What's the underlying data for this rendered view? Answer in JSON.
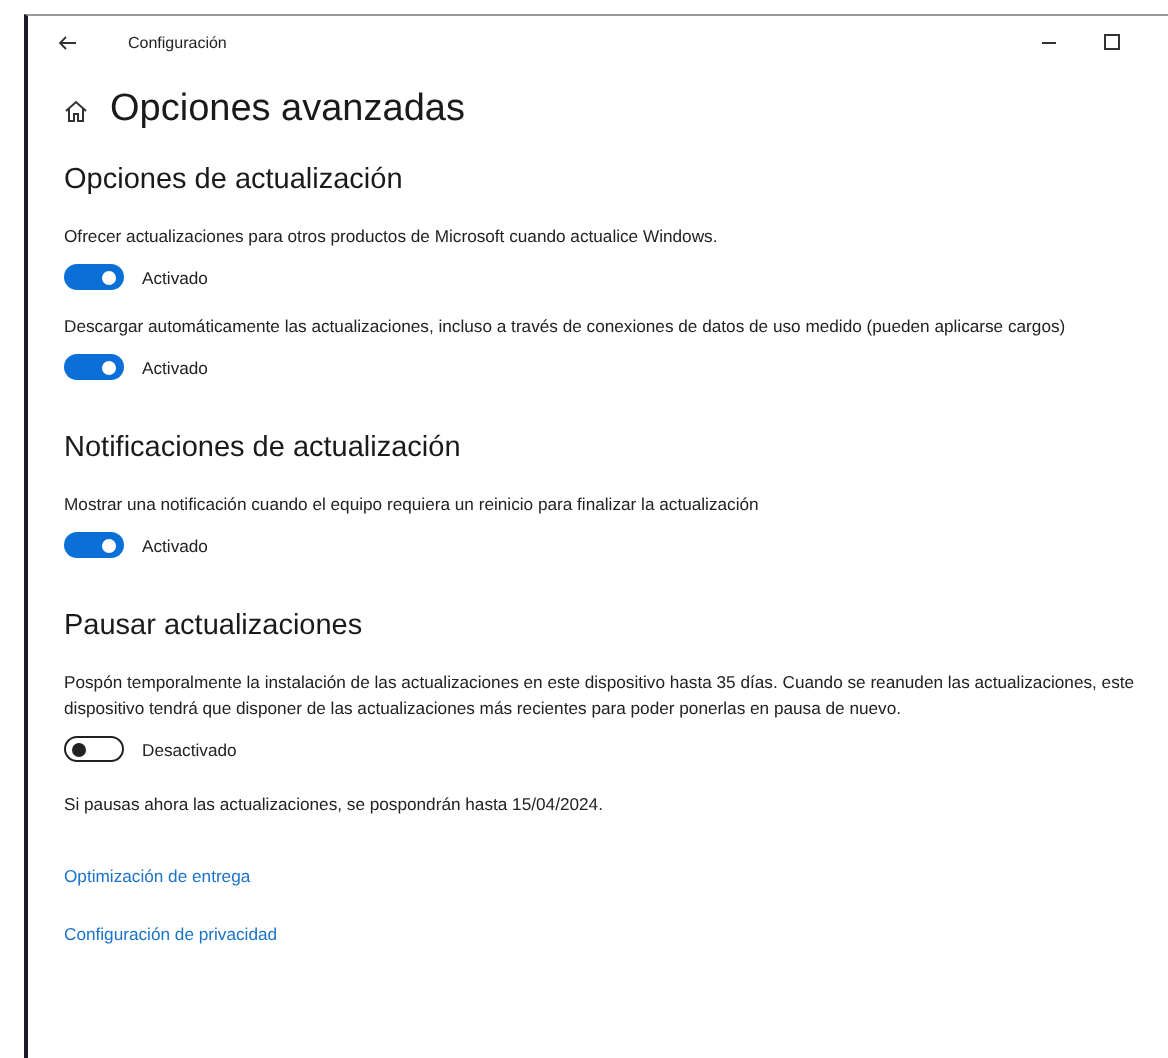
{
  "window": {
    "title": "Configuración"
  },
  "page": {
    "title": "Opciones avanzadas"
  },
  "sections": [
    {
      "title": "Opciones de actualización",
      "items": [
        {
          "kind": "toggle",
          "description": "Ofrecer actualizaciones para otros productos de Microsoft cuando actualice Windows.",
          "on": true,
          "state_label": "Activado"
        },
        {
          "kind": "toggle",
          "description": "Descargar automáticamente las actualizaciones, incluso a través de conexiones de datos de uso medido (pueden aplicarse cargos)",
          "on": true,
          "state_label": "Activado"
        }
      ]
    },
    {
      "title": "Notificaciones de actualización",
      "items": [
        {
          "kind": "toggle",
          "description": "Mostrar una notificación cuando el equipo requiera un reinicio para finalizar la actualización",
          "on": true,
          "state_label": "Activado"
        }
      ]
    },
    {
      "title": "Pausar actualizaciones",
      "items": [
        {
          "kind": "toggle",
          "description": "Pospón temporalmente la instalación de las actualizaciones en este dispositivo hasta 35 días. Cuando se reanuden las actualizaciones, este dispositivo tendrá que disponer de las actualizaciones más recientes para poder ponerlas en pausa de nuevo.",
          "on": false,
          "state_label": "Desactivado"
        },
        {
          "kind": "note",
          "text": "Si pausas ahora las actualizaciones, se pospondrán hasta 15/04/2024."
        }
      ]
    }
  ],
  "links": [
    "Optimización de entrega",
    "Configuración de privacidad"
  ]
}
